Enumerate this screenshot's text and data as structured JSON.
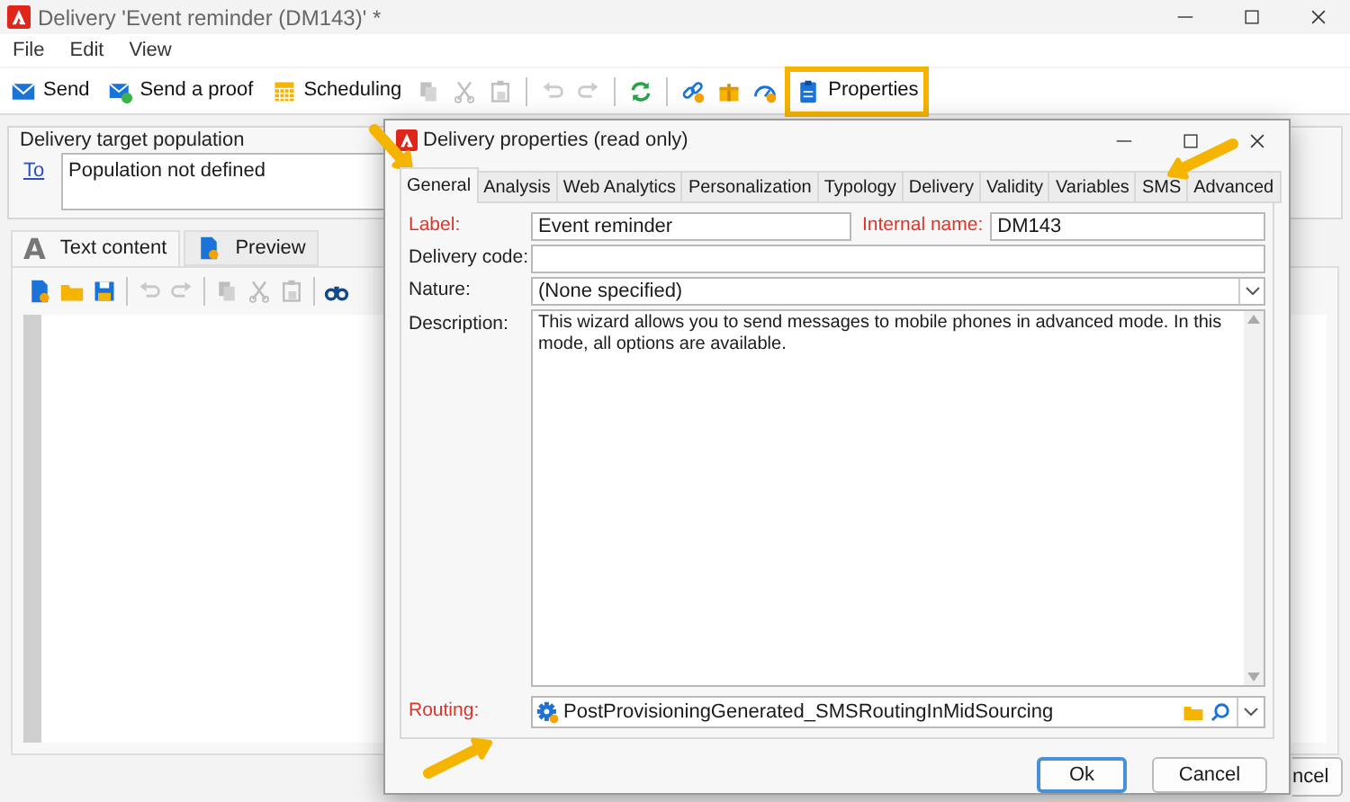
{
  "window": {
    "title": "Delivery 'Event reminder (DM143)' *"
  },
  "menu": [
    "File",
    "Edit",
    "View"
  ],
  "toolbar": [
    {
      "kind": "send",
      "label": "Send",
      "disabled": false
    },
    {
      "kind": "proof",
      "label": "Send a proof",
      "disabled": false
    },
    {
      "kind": "calendar",
      "label": "Scheduling",
      "disabled": false
    },
    {
      "kind": "copy",
      "disabled": true
    },
    {
      "kind": "cut",
      "disabled": true
    },
    {
      "kind": "paste",
      "disabled": true
    },
    {
      "kind": "sep"
    },
    {
      "kind": "undo",
      "disabled": true
    },
    {
      "kind": "redo",
      "disabled": true
    },
    {
      "kind": "sep"
    },
    {
      "kind": "refresh",
      "disabled": false
    },
    {
      "kind": "sep"
    },
    {
      "kind": "link",
      "disabled": false
    },
    {
      "kind": "gift",
      "disabled": false
    },
    {
      "kind": "gauge",
      "disabled": false
    },
    {
      "kind": "clipboard",
      "label": "Properties",
      "disabled": false,
      "highlighted": true
    }
  ],
  "target_population": {
    "title": "Delivery target population",
    "link": "To",
    "value": "Population not defined"
  },
  "content_tabs": [
    {
      "label": "Text content",
      "selected": true,
      "kind": "text",
      "glyph": "A"
    },
    {
      "label": "Preview",
      "selected": false,
      "kind": "preview"
    }
  ],
  "editor_toolbar": [
    {
      "kind": "new",
      "disabled": false
    },
    {
      "kind": "open",
      "disabled": false
    },
    {
      "kind": "save",
      "disabled": false
    },
    {
      "kind": "sep"
    },
    {
      "kind": "undo",
      "disabled": true
    },
    {
      "kind": "redo",
      "disabled": true
    },
    {
      "kind": "sep"
    },
    {
      "kind": "copy",
      "disabled": true
    },
    {
      "kind": "cut",
      "disabled": true
    },
    {
      "kind": "paste",
      "disabled": true
    },
    {
      "kind": "sep"
    },
    {
      "kind": "binoculars",
      "disabled": false
    }
  ],
  "background_button": "ncel",
  "dialog": {
    "title": "Delivery properties (read only)",
    "tabs": [
      {
        "label": "General",
        "selected": true
      },
      {
        "label": "Analysis",
        "selected": false
      },
      {
        "label": "Web Analytics",
        "selected": false
      },
      {
        "label": "Personalization",
        "selected": false
      },
      {
        "label": "Typology",
        "selected": false
      },
      {
        "label": "Delivery",
        "selected": false
      },
      {
        "label": "Validity",
        "selected": false
      },
      {
        "label": "Variables",
        "selected": false
      },
      {
        "label": "SMS",
        "selected": false
      },
      {
        "label": "Advanced",
        "selected": false
      }
    ],
    "label": {
      "caption": "Label:",
      "value": "Event reminder",
      "required": true
    },
    "internal_name": {
      "caption": "Internal name:",
      "value": "DM143",
      "required": true
    },
    "delivery_code": {
      "caption": "Delivery code:",
      "required": false
    },
    "nature": {
      "caption": "Nature:",
      "value": "(None specified)",
      "required": false
    },
    "description": {
      "caption": "Description:",
      "value": "This wizard allows you to send messages to mobile phones in advanced mode. In this mode, all options are available.",
      "required": false
    },
    "routing": {
      "caption": "Routing:",
      "value": "PostProvisioningGenerated_SMSRoutingInMidSourcing",
      "required": true
    },
    "buttons": [
      {
        "label": "Ok",
        "default": true
      },
      {
        "label": "Cancel",
        "default": false
      }
    ]
  }
}
